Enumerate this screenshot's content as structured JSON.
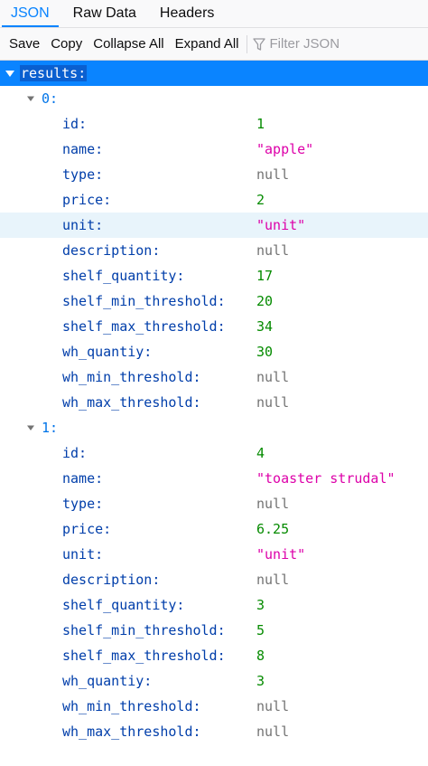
{
  "tabs": [
    {
      "label": "JSON",
      "active": true
    },
    {
      "label": "Raw Data",
      "active": false
    },
    {
      "label": "Headers",
      "active": false
    }
  ],
  "toolbar": {
    "save": "Save",
    "copy": "Copy",
    "collapse_all": "Collapse All",
    "expand_all": "Expand All",
    "filter_placeholder": "Filter JSON"
  },
  "tree": {
    "root_key": "results:",
    "items": [
      {
        "index_label": "0:",
        "fields": [
          {
            "key": "id:",
            "value": "1",
            "type": "number"
          },
          {
            "key": "name:",
            "value": "\"apple\"",
            "type": "string"
          },
          {
            "key": "type:",
            "value": "null",
            "type": "null"
          },
          {
            "key": "price:",
            "value": "2",
            "type": "number"
          },
          {
            "key": "unit:",
            "value": "\"unit\"",
            "type": "string"
          },
          {
            "key": "description:",
            "value": "null",
            "type": "null"
          },
          {
            "key": "shelf_quantity:",
            "value": "17",
            "type": "number"
          },
          {
            "key": "shelf_min_threshold:",
            "value": "20",
            "type": "number"
          },
          {
            "key": "shelf_max_threshold:",
            "value": "34",
            "type": "number"
          },
          {
            "key": "wh_quantiy:",
            "value": "30",
            "type": "number"
          },
          {
            "key": "wh_min_threshold:",
            "value": "null",
            "type": "null"
          },
          {
            "key": "wh_max_threshold:",
            "value": "null",
            "type": "null"
          }
        ]
      },
      {
        "index_label": "1:",
        "fields": [
          {
            "key": "id:",
            "value": "4",
            "type": "number"
          },
          {
            "key": "name:",
            "value": "\"toaster strudal\"",
            "type": "string"
          },
          {
            "key": "type:",
            "value": "null",
            "type": "null"
          },
          {
            "key": "price:",
            "value": "6.25",
            "type": "number"
          },
          {
            "key": "unit:",
            "value": "\"unit\"",
            "type": "string"
          },
          {
            "key": "description:",
            "value": "null",
            "type": "null"
          },
          {
            "key": "shelf_quantity:",
            "value": "3",
            "type": "number"
          },
          {
            "key": "shelf_min_threshold:",
            "value": "5",
            "type": "number"
          },
          {
            "key": "shelf_max_threshold:",
            "value": "8",
            "type": "number"
          },
          {
            "key": "wh_quantiy:",
            "value": "3",
            "type": "number"
          },
          {
            "key": "wh_min_threshold:",
            "value": "null",
            "type": "null"
          },
          {
            "key": "wh_max_threshold:",
            "value": "null",
            "type": "null"
          }
        ]
      }
    ]
  },
  "colors": {
    "accent": "#0a84ff",
    "number": "#058b00",
    "string": "#dd00a9",
    "null": "#737373",
    "key": "#003eaa",
    "hover_row": "#e8f4fb"
  }
}
